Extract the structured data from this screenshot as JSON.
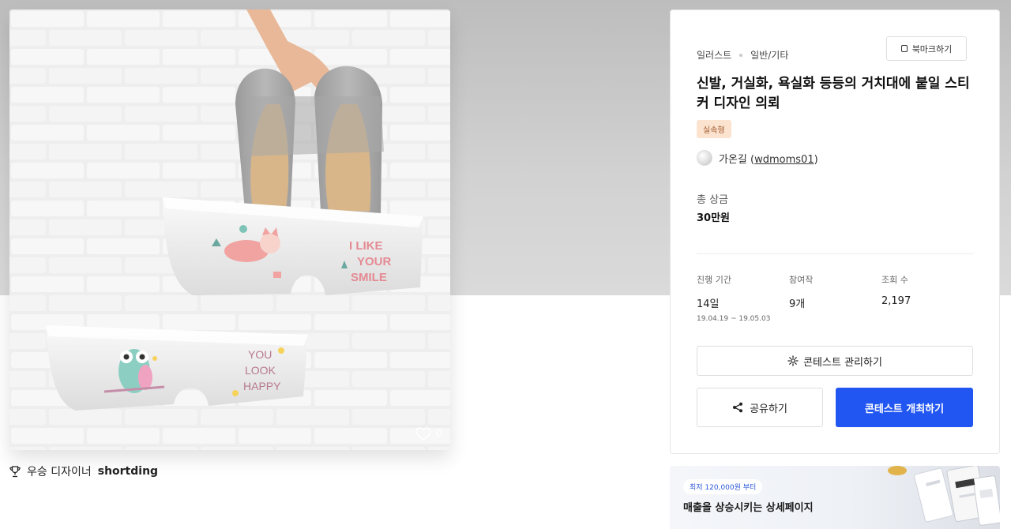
{
  "artwork": {
    "likes": "0",
    "text_top": [
      "I LIKE",
      "YOUR",
      "SMILE"
    ],
    "text_bottom": [
      "YOU",
      "LOOK",
      "HAPPY"
    ]
  },
  "winner": {
    "prefix": "우승 디자이너",
    "name": "shortding"
  },
  "contest": {
    "category_main": "일러스트",
    "category_sub": "일반/기타",
    "bookmark_label": "북마크하기",
    "title": "신발, 거실화, 욕실화 등등의 거치대에 붙일 스티커 디자인 의뢰",
    "tag": "실속형",
    "author_name": "가온길",
    "author_id": "wdmoms01",
    "prize_label": "총 상금",
    "prize_value": "30만원",
    "stats": {
      "period_label": "진행 기간",
      "period_value": "14일",
      "period_dates": "19.04.19 ~ 19.05.03",
      "entries_label": "참여작",
      "entries_value": "9개",
      "views_label": "조회 수",
      "views_value": "2,197"
    },
    "manage_label": "콘테스트 관리하기",
    "share_label": "공유하기",
    "host_label": "콘테스트 개최하기"
  },
  "ad": {
    "pill": "최저 120,000원 부터",
    "headline": "매출을 상승시키는 상세페이지"
  },
  "colors": {
    "primary": "#2256f2",
    "tag_bg": "#fbe3d0",
    "tag_text": "#a25a2a",
    "hero_bg": "#cccccc"
  },
  "icons": [
    "heart-icon",
    "trophy-icon",
    "bookmark-icon",
    "gear-icon",
    "share-icon"
  ]
}
